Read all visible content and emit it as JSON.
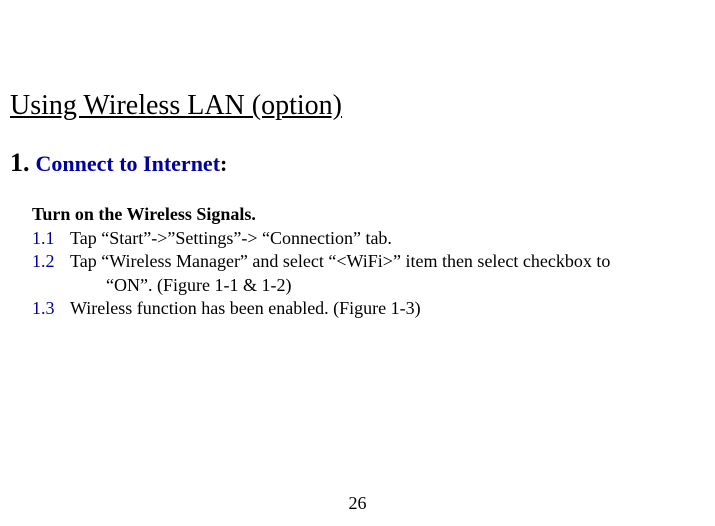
{
  "section_title": "Using Wireless LAN (option)",
  "subsection": {
    "number": "1.",
    "text": "Connect to Internet",
    "colon": ":"
  },
  "instruction_heading": "Turn on the Wireless Signals.",
  "steps": [
    {
      "number": "1.1",
      "text": "Tap “Start”->”Settings”-> “Connection” tab."
    },
    {
      "number": "1.2",
      "text": "Tap “Wireless Manager” and select “<WiFi>” item then select checkbox to",
      "continuation": "“ON”. (Figure 1-1 & 1-2)"
    },
    {
      "number": "1.3",
      "text": "Wireless function has been enabled. (Figure 1-3)"
    }
  ],
  "page_number": "26"
}
